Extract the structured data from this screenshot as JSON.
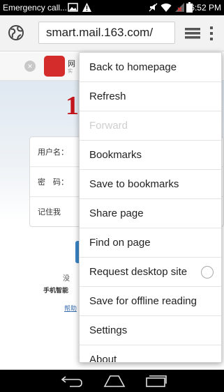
{
  "status_bar": {
    "carrier": "Emergency call...",
    "time": "6:52 PM",
    "icons": [
      "image-icon",
      "warning-icon",
      "no-sound-icon",
      "wifi-icon",
      "signal-icon",
      "battery-icon"
    ]
  },
  "toolbar": {
    "url": "smart.mail.163.com/",
    "icons": [
      "globe-icon",
      "tabs-icon",
      "more-vert-icon"
    ]
  },
  "page": {
    "promo_title": "网",
    "promo_sub": "实",
    "brand": "1",
    "form": {
      "username_label": "用户名：",
      "password_label": "密　码：",
      "remember_label": "记住我"
    },
    "no_account": "没",
    "phone_line": "手机智能",
    "help_link": "帮助"
  },
  "menu": {
    "items": [
      {
        "label": "Back to homepage",
        "enabled": true
      },
      {
        "label": "Refresh",
        "enabled": true
      },
      {
        "label": "Forward",
        "enabled": false
      },
      {
        "label": "Bookmarks",
        "enabled": true
      },
      {
        "label": "Save to bookmarks",
        "enabled": true
      },
      {
        "label": "Share page",
        "enabled": true
      },
      {
        "label": "Find on page",
        "enabled": true
      },
      {
        "label": "Request desktop site",
        "enabled": true,
        "toggle": false
      },
      {
        "label": "Save for offline reading",
        "enabled": true
      },
      {
        "label": "Settings",
        "enabled": true
      },
      {
        "label": "About",
        "enabled": true
      }
    ]
  },
  "nav_bar": {
    "icons": [
      "back-icon",
      "home-icon",
      "recent-apps-icon"
    ]
  },
  "colors": {
    "brand_red": "#c4151c",
    "link_blue": "#3b6fb0",
    "button_blue": "#3b87c8"
  }
}
